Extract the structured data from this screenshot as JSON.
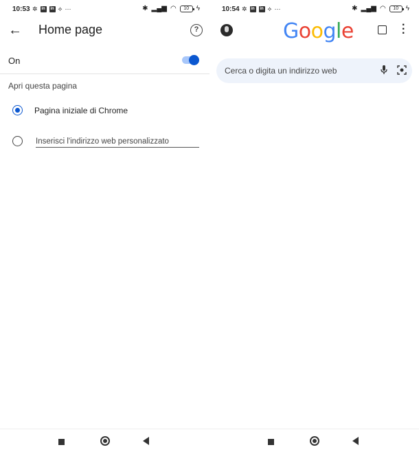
{
  "left_screen": {
    "status": {
      "time": "10:53"
    },
    "header": {
      "title": "Home page"
    },
    "toggle": {
      "label": "On",
      "state": "on"
    },
    "section_label": "Apri questa pagina",
    "options": [
      {
        "label": "Pagina iniziale di Chrome",
        "selected": true
      },
      {
        "placeholder": "Inserisci l'indirizzo web personalizzato",
        "selected": false
      }
    ]
  },
  "right_screen": {
    "status": {
      "time": "10:54"
    },
    "logo_text": "Google",
    "search": {
      "placeholder": "Cerca o digita un indirizzo web"
    }
  },
  "status_icons": {
    "left": [
      "gear-icon",
      "linkedin-icon",
      "linkedin-icon",
      "sync-icon",
      "more-icon"
    ],
    "right": [
      "bluetooth-icon",
      "signal-icon",
      "wifi-icon",
      "battery-icon",
      "charging-icon"
    ],
    "battery_text": "10"
  },
  "colors": {
    "accent": "#0b57d0",
    "toggle_track": "#a8c7fa",
    "search_bg": "#eef3fb",
    "google_blue": "#4285f4",
    "google_red": "#ea4335",
    "google_yellow": "#fbbc05",
    "google_green": "#34a853"
  }
}
